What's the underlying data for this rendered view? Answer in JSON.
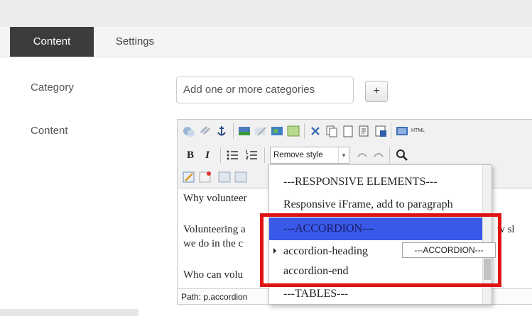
{
  "tabs": [
    {
      "label": "Content"
    },
    {
      "label": "Settings"
    }
  ],
  "form": {
    "category_label": "Category",
    "category_placeholder": "Add one or more categories",
    "add_button": "+",
    "content_label": "Content"
  },
  "toolbar": {
    "bold": "B",
    "italic": "I",
    "style_select": "Remove style",
    "style_arrow": "▾",
    "html_label": "HTML"
  },
  "editor": {
    "lines": [
      "Why volunteer",
      "Volunteering a",
      "we do in the c",
      "Who can volu"
    ],
    "path": "Path: p.accordion"
  },
  "dropdown": {
    "items": [
      "---RESPONSIVE ELEMENTS---",
      "Responsive iFrame, add to paragraph",
      "---ACCORDION---",
      "accordion-heading",
      "accordion-end",
      "---TABLES---"
    ],
    "selected_index": 2,
    "tooltip": "---ACCORDION---",
    "behind_text": "w sl"
  },
  "colors": {
    "active_tab": "#3c3c3c",
    "selection": "#3959e9",
    "highlight_box": "#e01313"
  }
}
